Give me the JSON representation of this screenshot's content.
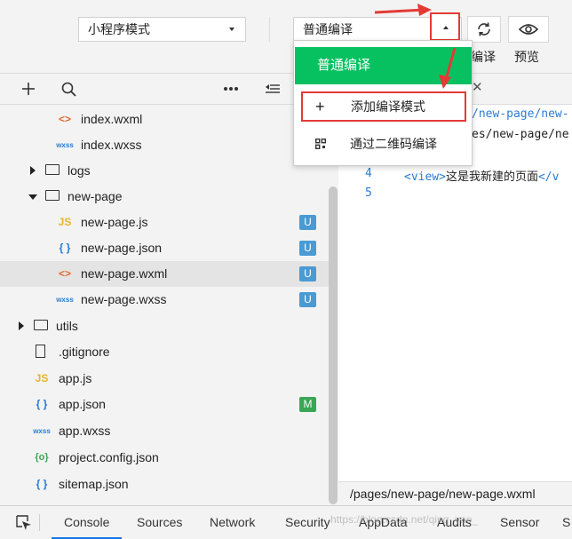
{
  "toolbar": {
    "mode_select": "小程序模式",
    "compile_select": "普通编译",
    "compile_label": "编译",
    "preview_label": "预览"
  },
  "dropdown": {
    "header": "普通编译",
    "add_mode": "添加编译模式",
    "add_icon": "+",
    "qr_compile": "通过二维码编译"
  },
  "explorer_icons": [
    "add-icon",
    "search-icon",
    "more-icon",
    "collapse-icon"
  ],
  "files": [
    {
      "name": "index.wxml",
      "icon": "<>",
      "badge": ""
    },
    {
      "name": "index.wxss",
      "icon": "wxss",
      "badge": ""
    },
    {
      "name": "logs",
      "icon": "folder",
      "badge": ""
    },
    {
      "name": "new-page",
      "icon": "folder-open",
      "badge": ""
    },
    {
      "name": "new-page.js",
      "icon": "JS",
      "badge": "U"
    },
    {
      "name": "new-page.json",
      "icon": "{}",
      "badge": "U"
    },
    {
      "name": "new-page.wxml",
      "icon": "<>",
      "badge": "U"
    },
    {
      "name": "new-page.wxss",
      "icon": "wxss",
      "badge": "U"
    },
    {
      "name": "utils",
      "icon": "folder",
      "badge": ""
    },
    {
      "name": ".gitignore",
      "icon": "file",
      "badge": ""
    },
    {
      "name": "app.js",
      "icon": "JS",
      "badge": ""
    },
    {
      "name": "app.json",
      "icon": "{}",
      "badge": "M"
    },
    {
      "name": "app.wxss",
      "icon": "wxss",
      "badge": ""
    },
    {
      "name": "project.config.json",
      "icon": "{o}",
      "badge": ""
    },
    {
      "name": "sitemap.json",
      "icon": "{}",
      "badge": ""
    }
  ],
  "editor": {
    "line1": "/new-page/new-",
    "line2": "es/new-page/ne",
    "line4_num": "4",
    "line4_open": "<view>",
    "line4_text": "这是我新建的页面",
    "line4_close": "</v",
    "line5_num": "5",
    "path": "/pages/new-page/new-page.wxml"
  },
  "devtools_tabs": [
    "Console",
    "Sources",
    "Network",
    "Security",
    "AppData",
    "Audits",
    "Sensor",
    "S"
  ],
  "watermark": "https://blog.csdn.net/qing_yao_",
  "colors": {
    "accent_green": "#07c160",
    "badge_blue": "#4a9ad4",
    "badge_green": "#3aa655",
    "annotation_red": "#e33a35",
    "tab_blue": "#1a73e8"
  }
}
